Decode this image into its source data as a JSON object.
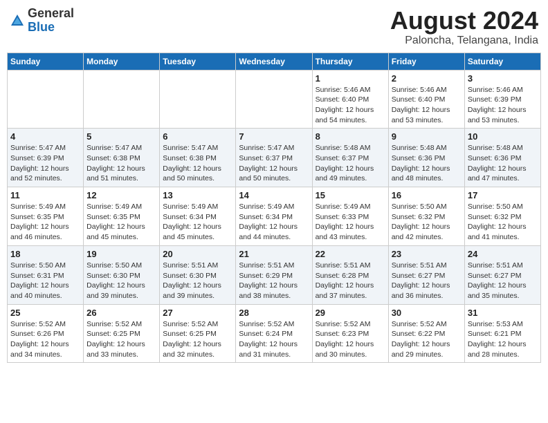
{
  "logo": {
    "general": "General",
    "blue": "Blue"
  },
  "header": {
    "month": "August 2024",
    "location": "Paloncha, Telangana, India"
  },
  "days_of_week": [
    "Sunday",
    "Monday",
    "Tuesday",
    "Wednesday",
    "Thursday",
    "Friday",
    "Saturday"
  ],
  "weeks": [
    [
      {
        "day": "",
        "info": ""
      },
      {
        "day": "",
        "info": ""
      },
      {
        "day": "",
        "info": ""
      },
      {
        "day": "",
        "info": ""
      },
      {
        "day": "1",
        "info": "Sunrise: 5:46 AM\nSunset: 6:40 PM\nDaylight: 12 hours\nand 54 minutes."
      },
      {
        "day": "2",
        "info": "Sunrise: 5:46 AM\nSunset: 6:40 PM\nDaylight: 12 hours\nand 53 minutes."
      },
      {
        "day": "3",
        "info": "Sunrise: 5:46 AM\nSunset: 6:39 PM\nDaylight: 12 hours\nand 53 minutes."
      }
    ],
    [
      {
        "day": "4",
        "info": "Sunrise: 5:47 AM\nSunset: 6:39 PM\nDaylight: 12 hours\nand 52 minutes."
      },
      {
        "day": "5",
        "info": "Sunrise: 5:47 AM\nSunset: 6:38 PM\nDaylight: 12 hours\nand 51 minutes."
      },
      {
        "day": "6",
        "info": "Sunrise: 5:47 AM\nSunset: 6:38 PM\nDaylight: 12 hours\nand 50 minutes."
      },
      {
        "day": "7",
        "info": "Sunrise: 5:47 AM\nSunset: 6:37 PM\nDaylight: 12 hours\nand 50 minutes."
      },
      {
        "day": "8",
        "info": "Sunrise: 5:48 AM\nSunset: 6:37 PM\nDaylight: 12 hours\nand 49 minutes."
      },
      {
        "day": "9",
        "info": "Sunrise: 5:48 AM\nSunset: 6:36 PM\nDaylight: 12 hours\nand 48 minutes."
      },
      {
        "day": "10",
        "info": "Sunrise: 5:48 AM\nSunset: 6:36 PM\nDaylight: 12 hours\nand 47 minutes."
      }
    ],
    [
      {
        "day": "11",
        "info": "Sunrise: 5:49 AM\nSunset: 6:35 PM\nDaylight: 12 hours\nand 46 minutes."
      },
      {
        "day": "12",
        "info": "Sunrise: 5:49 AM\nSunset: 6:35 PM\nDaylight: 12 hours\nand 45 minutes."
      },
      {
        "day": "13",
        "info": "Sunrise: 5:49 AM\nSunset: 6:34 PM\nDaylight: 12 hours\nand 45 minutes."
      },
      {
        "day": "14",
        "info": "Sunrise: 5:49 AM\nSunset: 6:34 PM\nDaylight: 12 hours\nand 44 minutes."
      },
      {
        "day": "15",
        "info": "Sunrise: 5:49 AM\nSunset: 6:33 PM\nDaylight: 12 hours\nand 43 minutes."
      },
      {
        "day": "16",
        "info": "Sunrise: 5:50 AM\nSunset: 6:32 PM\nDaylight: 12 hours\nand 42 minutes."
      },
      {
        "day": "17",
        "info": "Sunrise: 5:50 AM\nSunset: 6:32 PM\nDaylight: 12 hours\nand 41 minutes."
      }
    ],
    [
      {
        "day": "18",
        "info": "Sunrise: 5:50 AM\nSunset: 6:31 PM\nDaylight: 12 hours\nand 40 minutes."
      },
      {
        "day": "19",
        "info": "Sunrise: 5:50 AM\nSunset: 6:30 PM\nDaylight: 12 hours\nand 39 minutes."
      },
      {
        "day": "20",
        "info": "Sunrise: 5:51 AM\nSunset: 6:30 PM\nDaylight: 12 hours\nand 39 minutes."
      },
      {
        "day": "21",
        "info": "Sunrise: 5:51 AM\nSunset: 6:29 PM\nDaylight: 12 hours\nand 38 minutes."
      },
      {
        "day": "22",
        "info": "Sunrise: 5:51 AM\nSunset: 6:28 PM\nDaylight: 12 hours\nand 37 minutes."
      },
      {
        "day": "23",
        "info": "Sunrise: 5:51 AM\nSunset: 6:27 PM\nDaylight: 12 hours\nand 36 minutes."
      },
      {
        "day": "24",
        "info": "Sunrise: 5:51 AM\nSunset: 6:27 PM\nDaylight: 12 hours\nand 35 minutes."
      }
    ],
    [
      {
        "day": "25",
        "info": "Sunrise: 5:52 AM\nSunset: 6:26 PM\nDaylight: 12 hours\nand 34 minutes."
      },
      {
        "day": "26",
        "info": "Sunrise: 5:52 AM\nSunset: 6:25 PM\nDaylight: 12 hours\nand 33 minutes."
      },
      {
        "day": "27",
        "info": "Sunrise: 5:52 AM\nSunset: 6:25 PM\nDaylight: 12 hours\nand 32 minutes."
      },
      {
        "day": "28",
        "info": "Sunrise: 5:52 AM\nSunset: 6:24 PM\nDaylight: 12 hours\nand 31 minutes."
      },
      {
        "day": "29",
        "info": "Sunrise: 5:52 AM\nSunset: 6:23 PM\nDaylight: 12 hours\nand 30 minutes."
      },
      {
        "day": "30",
        "info": "Sunrise: 5:52 AM\nSunset: 6:22 PM\nDaylight: 12 hours\nand 29 minutes."
      },
      {
        "day": "31",
        "info": "Sunrise: 5:53 AM\nSunset: 6:21 PM\nDaylight: 12 hours\nand 28 minutes."
      }
    ]
  ]
}
